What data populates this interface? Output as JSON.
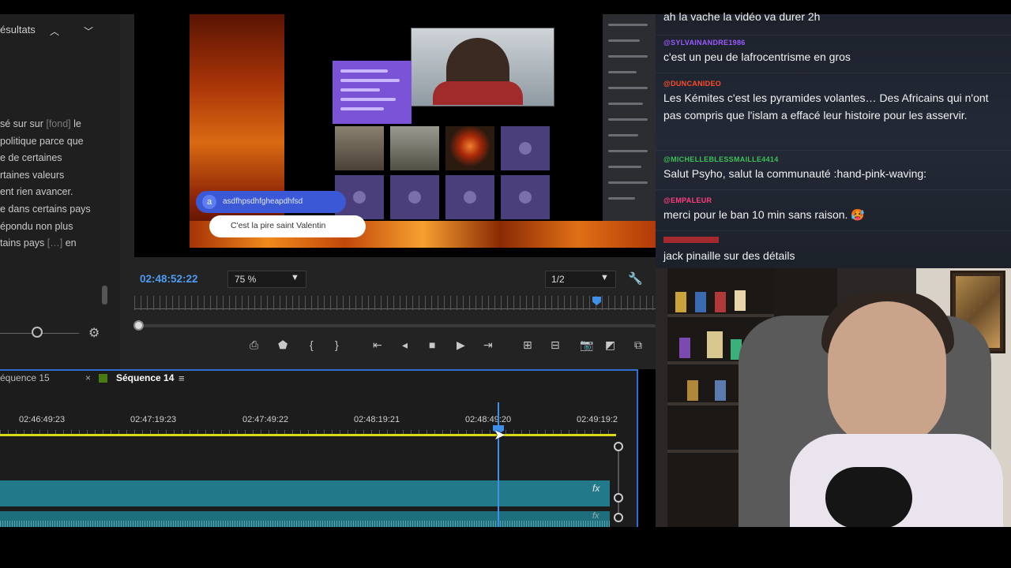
{
  "left_panel": {
    "results_label": "ésultats",
    "lines": [
      {
        "pre": "sé sur sur ",
        "dim": "[fond]",
        "post": " le"
      },
      {
        "pre": "politique parce que",
        "dim": "",
        "post": ""
      },
      {
        "pre": "e de certaines",
        "dim": "",
        "post": ""
      },
      {
        "pre": "rtaines valeurs",
        "dim": "",
        "post": ""
      },
      {
        "pre": "ent rien avancer.",
        "dim": "",
        "post": ""
      },
      {
        "pre": "e dans certains pays",
        "dim": "",
        "post": ""
      },
      {
        "pre": "épondu non plus",
        "dim": "",
        "post": ""
      },
      {
        "pre": "tains pays ",
        "dim": "[…]",
        "post": " en"
      }
    ]
  },
  "video": {
    "bubble_name": "asdfhpsdhfgheapdhfsd",
    "bubble_initial": "a",
    "bubble_text": "C'est la pire saint Valentin"
  },
  "monitor": {
    "timecode": "02:48:52:22",
    "zoom": "75 %",
    "resolution": "1/2"
  },
  "timeline": {
    "tab_other": "équence 15",
    "tab_active": "Séquence 14",
    "timecodes": [
      "02:46:49:23",
      "02:47:19:23",
      "02:47:49:22",
      "02:48:19:21",
      "02:48:49:20",
      "02:49:19:2"
    ],
    "fx_label": "fx"
  },
  "chat": {
    "messages": [
      {
        "user": "",
        "text": "ah la vache la vidéo va durer 2h",
        "color": "#ffffff"
      },
      {
        "user": "@SYLVAINANDRE1986",
        "text": "c'est un peu de lafrocentrisme en gros",
        "color": "#9b59ff"
      },
      {
        "user": "@DUNCANIDEO",
        "text": "Les Kémites c'est les pyramides volantes… Des Africains qui n'ont pas compris que l'islam a effacé leur histoire pour les asservir.",
        "color": "#ff4b2b"
      },
      {
        "user": "@MICHELLEBLESSMAILLE4414",
        "text": "Salut Psyho, salut la communauté :hand-pink-waving:",
        "color": "#3fbf5a"
      },
      {
        "user": "@EMPALEUR",
        "text": "merci pour le ban 10 min sans raison. 🥵",
        "color": "#ff3d7f"
      },
      {
        "user": "",
        "text": "jack pinaille sur des détails",
        "color": "#ff2d2d"
      }
    ]
  },
  "colors": {
    "accent": "#3d8fe8",
    "work_area": "#d9d91a",
    "clip": "#21798a"
  }
}
